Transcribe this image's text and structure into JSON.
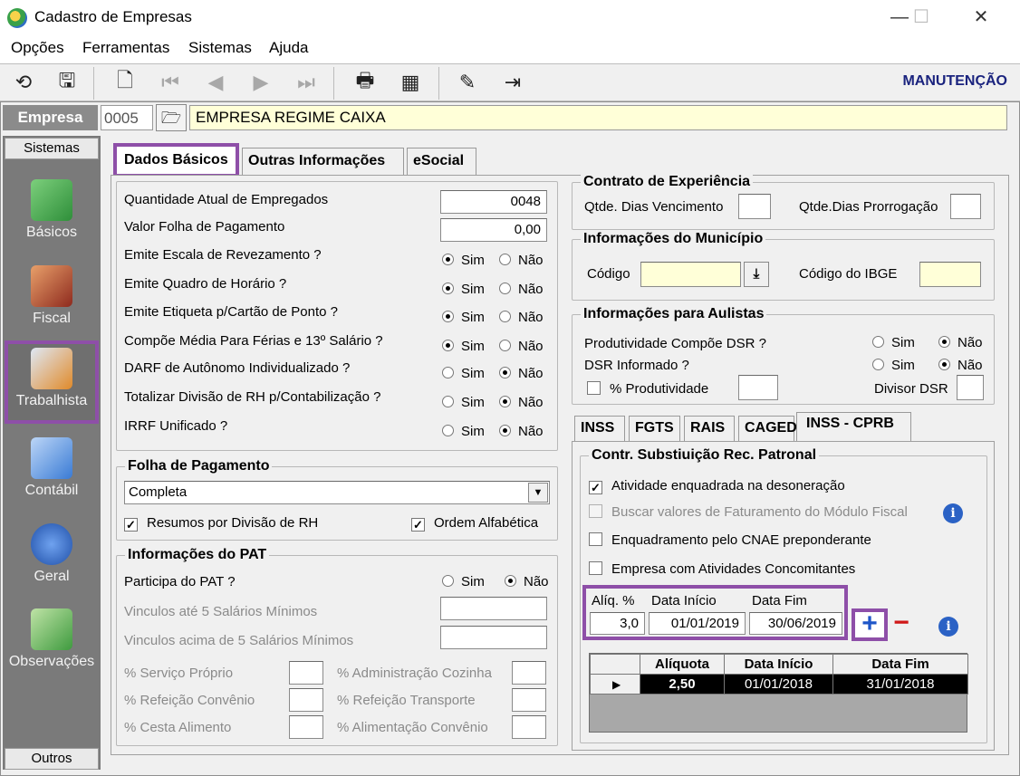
{
  "window": {
    "title": "Cadastro de Empresas",
    "min": "—",
    "max": "☐",
    "close": "✕"
  },
  "menu": [
    "Opções",
    "Ferramentas",
    "Sistemas",
    "Ajuda"
  ],
  "toolbar": {
    "mode": "MANUTENÇÃO",
    "icons": {
      "undo": "⟲",
      "save": "🖫",
      "preview": "🗋",
      "first": "⏮",
      "prev": "◀",
      "next": "▶",
      "last": "⏭",
      "print": "🖶",
      "calc": "▦",
      "edit": "✎",
      "exit": "⇥"
    }
  },
  "empresa": {
    "label": "Empresa",
    "code": "0005",
    "name": "EMPRESA REGIME CAIXA",
    "folder": "🗁"
  },
  "sidebar": {
    "header": "Sistemas",
    "footer": "Outros",
    "items": [
      {
        "label": "Básicos",
        "icon": "basicos-icon",
        "color": "#4aa04a"
      },
      {
        "label": "Fiscal",
        "icon": "fiscal-icon",
        "color": "#c0392b"
      },
      {
        "label": "Trabalhista",
        "icon": "trabalhista-icon",
        "color": "#e08a2a"
      },
      {
        "label": "Contábil",
        "icon": "contabil-icon",
        "color": "#3a7bd5"
      },
      {
        "label": "Geral",
        "icon": "geral-icon",
        "color": "#2b62c5"
      },
      {
        "label": "Observações",
        "icon": "observacoes-icon",
        "color": "#3f9b3f"
      }
    ]
  },
  "tabs": [
    "Dados Básicos",
    "Outras Informações",
    "eSocial"
  ],
  "left": {
    "fields": [
      {
        "label": "Quantidade Atual de Empregados",
        "value": "0048"
      },
      {
        "label": "Valor Folha de Pagamento",
        "value": "0,00"
      }
    ],
    "yes": "Sim",
    "no": "Não",
    "radios": [
      {
        "label": "Emite Escala de Revezamento ?",
        "sel": "sim"
      },
      {
        "label": "Emite Quadro de Horário ?",
        "sel": "sim"
      },
      {
        "label": "Emite Etiqueta p/Cartão de Ponto ?",
        "sel": "sim"
      },
      {
        "label": "Compõe Média Para Férias e 13º Salário ?",
        "sel": "sim"
      },
      {
        "label": "DARF de Autônomo Individualizado ?",
        "sel": "nao"
      },
      {
        "label": "Totalizar Divisão de RH p/Contabilização ?",
        "sel": "nao"
      },
      {
        "label": "IRRF Unificado ?",
        "sel": "nao"
      }
    ],
    "folha": {
      "title": "Folha de Pagamento",
      "select": "Completa",
      "chk1": "Resumos por Divisão de RH",
      "chk2": "Ordem Alfabética"
    },
    "pat": {
      "title": "Informações do PAT",
      "participa": "Participa do PAT ?",
      "sel": "nao",
      "v1": "Vinculos até 5 Salários Mínimos",
      "v2": "Vinculos acima de 5 Salários Mínimos",
      "p1": "% Serviço Próprio",
      "p2": "% Administração Cozinha",
      "p3": "% Refeição Convênio",
      "p4": "% Refeição Transporte",
      "p5": "% Cesta Alimento",
      "p6": "% Alimentação Convênio"
    }
  },
  "right": {
    "contrato": {
      "title": "Contrato de Experiência",
      "venc": "Qtde. Dias Vencimento",
      "prorr": "Qtde.Dias Prorrogação"
    },
    "municipio": {
      "title": "Informações do Município",
      "codigo": "Código",
      "ibge": "Código do IBGE"
    },
    "aulistas": {
      "title": "Informações para Aulistas",
      "q1": "Produtividade Compõe DSR ?",
      "q2": "DSR Informado ?",
      "prod": "% Produtividade",
      "divisor": "Divisor DSR"
    },
    "subtabs": [
      "INSS",
      "FGTS",
      "RAIS",
      "CAGED",
      "INSS - CPRB"
    ],
    "cprb": {
      "title": "Contr. Substiuição Rec. Patronal",
      "c1": "Atividade enquadrada na desoneração",
      "c2": "Buscar valores de Faturamento do Módulo Fiscal",
      "c3": "Enquadramento pelo CNAE preponderante",
      "c4": "Empresa com Atividades Concomitantes",
      "h_aliq": "Alíq. %",
      "h_ini": "Data Início",
      "h_fim": "Data Fim",
      "v_aliq": "3,0",
      "v_ini": "01/01/2019",
      "v_fim": "30/06/2019",
      "add": "+",
      "remove": "−",
      "info": "i",
      "grid": {
        "headers": [
          "Alíquota",
          "Data Início",
          "Data Fim"
        ],
        "rows": [
          [
            "2,50",
            "01/01/2018",
            "31/01/2018"
          ]
        ],
        "pointer": "▶"
      }
    }
  }
}
